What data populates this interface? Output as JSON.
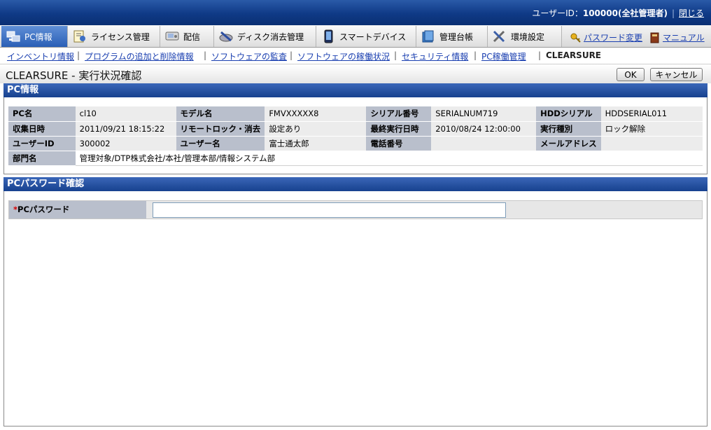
{
  "header": {
    "user_label": "ユーザーID：",
    "user_id": "100000(全社管理者)",
    "separator": "|",
    "close_link": "閉じる"
  },
  "tabs": [
    {
      "label": "PC情報",
      "icon": "pc-network-icon",
      "active": true
    },
    {
      "label": "ライセンス管理",
      "icon": "license-icon",
      "active": false
    },
    {
      "label": "配信",
      "icon": "distribution-icon",
      "active": false
    },
    {
      "label": "ディスク消去管理",
      "icon": "disk-erase-icon",
      "active": false
    },
    {
      "label": "スマートデバイス",
      "icon": "smart-device-icon",
      "active": false
    },
    {
      "label": "管理台帳",
      "icon": "ledger-icon",
      "active": false
    },
    {
      "label": "環境設定",
      "icon": "settings-tools-icon",
      "active": false
    }
  ],
  "tab_links": [
    {
      "label": "パスワード変更",
      "icon": "key-icon"
    },
    {
      "label": "マニュアル",
      "icon": "manual-book-icon"
    }
  ],
  "subnav": {
    "links": [
      "インベントリ情報",
      "プログラムの追加と削除情報",
      "ソフトウェアの監査",
      "ソフトウェアの稼働状況",
      "セキュリティ情報",
      "PC稼働管理"
    ],
    "current": "CLEARSURE",
    "separator": "|"
  },
  "page": {
    "title": "CLEARSURE - 実行状況確認",
    "ok_label": "OK",
    "cancel_label": "キャンセル"
  },
  "pc_info": {
    "heading": "PC情報",
    "rows": [
      [
        {
          "label": "PC名",
          "value": "cl10"
        },
        {
          "label": "モデル名",
          "value": "FMVXXXXX8"
        },
        {
          "label": "シリアル番号",
          "value": "SERIALNUM719"
        },
        {
          "label": "HDDシリアル",
          "value": "HDDSERIAL011"
        }
      ],
      [
        {
          "label": "収集日時",
          "value": "2011/09/21 18:15:22"
        },
        {
          "label": "リモートロック・消去",
          "value": "設定あり"
        },
        {
          "label": "最終実行日時",
          "value": "2010/08/24 12:00:00"
        },
        {
          "label": "実行種別",
          "value": "ロック解除"
        }
      ],
      [
        {
          "label": "ユーザーID",
          "value": "300002"
        },
        {
          "label": "ユーザー名",
          "value": "富士通太郎"
        },
        {
          "label": "電話番号",
          "value": ""
        },
        {
          "label": "メールアドレス",
          "value": ""
        }
      ]
    ],
    "dept_label": "部門名",
    "dept_value": "管理対象/DTP株式会社/本社/管理本部/情報システム部"
  },
  "pc_password": {
    "heading": "PCパスワード確認",
    "required_mark": "*",
    "label": "PCパスワード",
    "value": ""
  }
}
